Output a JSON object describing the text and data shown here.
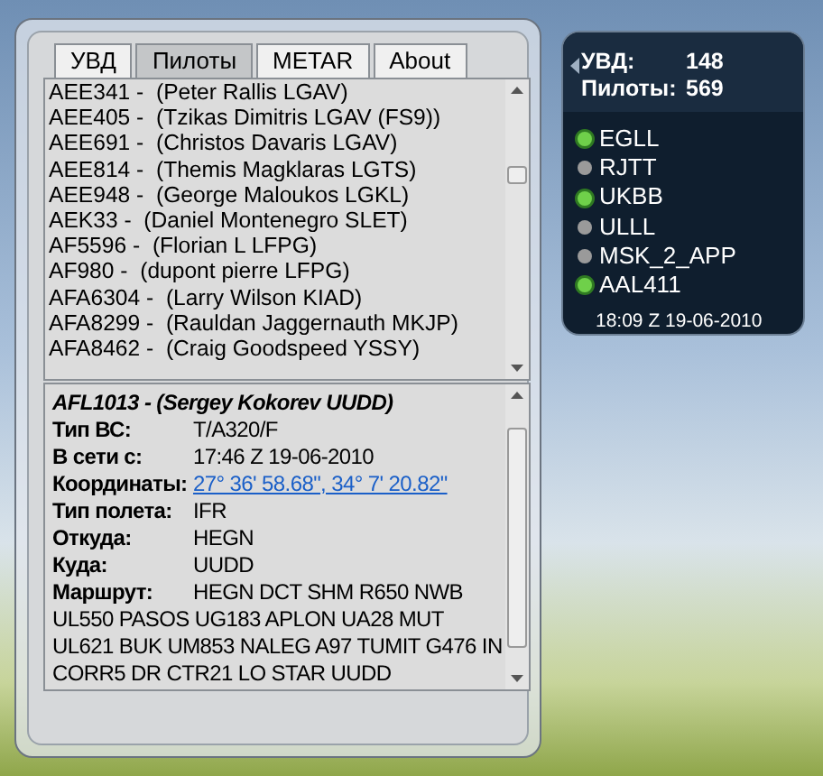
{
  "tabs": [
    {
      "label": "УВД",
      "selected": false
    },
    {
      "label": "Пилоты",
      "selected": true
    },
    {
      "label": "METAR",
      "selected": false
    },
    {
      "label": "About",
      "selected": false
    }
  ],
  "pilots": [
    {
      "callsign": "AEE341 -",
      "name": "(Peter Rallis LGAV)"
    },
    {
      "callsign": "AEE405 -",
      "name": "(Tzikas Dimitris LGAV (FS9))"
    },
    {
      "callsign": "AEE691 -",
      "name": "(Christos Davaris LGAV)"
    },
    {
      "callsign": "AEE814 -",
      "name": "(Themis Magklaras LGTS)"
    },
    {
      "callsign": "AEE948 -",
      "name": "(George Maloukos LGKL)"
    },
    {
      "callsign": "AEK33 -",
      "name": "(Daniel Montenegro SLET)"
    },
    {
      "callsign": "AF5596 -",
      "name": "(Florian L LFPG)"
    },
    {
      "callsign": "AF980 -",
      "name": "(dupont pierre LFPG)"
    },
    {
      "callsign": "AFA6304 -",
      "name": "(Larry Wilson KIAD)"
    },
    {
      "callsign": "AFA8299 -",
      "name": "(Rauldan Jaggernauth MKJP)"
    },
    {
      "callsign": "AFA8462 -",
      "name": "(Craig Goodspeed YSSY)"
    }
  ],
  "details": {
    "heading": "AFL1013 -  (Sergey Kokorev UUDD)",
    "fields": [
      {
        "label": "Тип ВС:",
        "value": "T/A320/F",
        "kind": "text"
      },
      {
        "label": "В сети с:",
        "value": "17:46 Z   19-06-2010",
        "kind": "text"
      },
      {
        "label": "Координаты:",
        "value": "27° 36' 58.68\", 34° 7' 20.82\"",
        "kind": "link"
      },
      {
        "label": "Тип полета:",
        "value": "IFR",
        "kind": "text"
      },
      {
        "label": "Откуда:",
        "value": "HEGN",
        "kind": "text"
      },
      {
        "label": "Куда:",
        "value": "UUDD",
        "kind": "text"
      },
      {
        "label": "Маршрут:",
        "value": "HEGN DCT SHM R650 NWB",
        "kind": "text"
      }
    ],
    "route_continuation": "UL550 PASOS UG183 APLON UA28 MUT UL621 BUK UM853 NALEG A97 TUMIT G476 IN CORR5 DR CTR21 LO STAR UUDD"
  },
  "gadget": {
    "stats": [
      {
        "label": "УВД:",
        "value": "148"
      },
      {
        "label": "Пилоты:",
        "value": "569"
      }
    ],
    "watch": [
      {
        "name": "EGLL",
        "on": true
      },
      {
        "name": "RJTT",
        "on": false
      },
      {
        "name": "UKBB",
        "on": true
      },
      {
        "name": "ULLL",
        "on": false
      },
      {
        "name": "MSK_2_APP",
        "on": false
      },
      {
        "name": "AAL411",
        "on": true
      }
    ],
    "updated": "18:09 Z   19-06-2010"
  }
}
